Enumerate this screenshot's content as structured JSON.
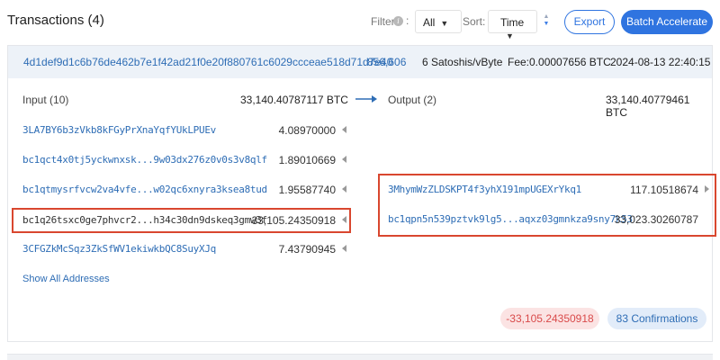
{
  "header": {
    "title": "Transactions (4)",
    "filter_label": "Filter",
    "filter_info_icon": "i",
    "filter_colon": ":",
    "filter_value": "All",
    "sort_label": "Sort:",
    "sort_value": "Time",
    "export_label": "Export",
    "batch_label": "Batch Accelerate"
  },
  "tx": {
    "hash": "4d1def9d1c6b76de462b7e1f42ad21f0e20f880761c6029ccceae518d71d7e40",
    "block": "856,606",
    "fee_rate": "6 Satoshis/vByte",
    "fee": "Fee:0.00007656 BTC",
    "time": "2024-08-13 22:40:15"
  },
  "inputs": {
    "heading": "Input (10)",
    "total": "33,140.40787117 BTC",
    "items": [
      {
        "address": "3LA7BY6b3zVkb8kFGyPrXnaYqfYUkLPUEv",
        "amount": "4.08970000"
      },
      {
        "address": "bc1qct4x0tj5yckwnxsk...9w03dx276z0v0s3v8qlf",
        "amount": "1.89010669"
      },
      {
        "address": "bc1qtmysrfvcw2va4vfe...w02qc6xnyra3ksea8tud",
        "amount": "1.95587740"
      },
      {
        "address": "bc1q26tsxc0ge7phvcr2...h34c30dn9dskeq3gmw3f",
        "amount": "33,105.24350918"
      },
      {
        "address": "3CFGZkMcSqz3ZkSfWV1ekiwkbQC8SuyXJq",
        "amount": "7.43790945"
      }
    ],
    "show_all": "Show All Addresses"
  },
  "outputs": {
    "heading": "Output (2)",
    "total": "33,140.40779461 BTC",
    "items": [
      {
        "address": "3MhymWzZLDSKPT4f3yhX191mpUGEXrYkq1",
        "amount": "117.10518674"
      },
      {
        "address": "bc1qpn5n539pztvk9lg5...aqxz03gmnkza9sny7k53",
        "amount": "33,023.30260787"
      }
    ]
  },
  "footer": {
    "net_change": "-33,105.24350918",
    "confirmations": "83 Confirmations"
  },
  "colors": {
    "accent": "#2f74e0",
    "link": "#2e6db5",
    "highlight": "#d9472f",
    "negative": "#d94a4a"
  }
}
